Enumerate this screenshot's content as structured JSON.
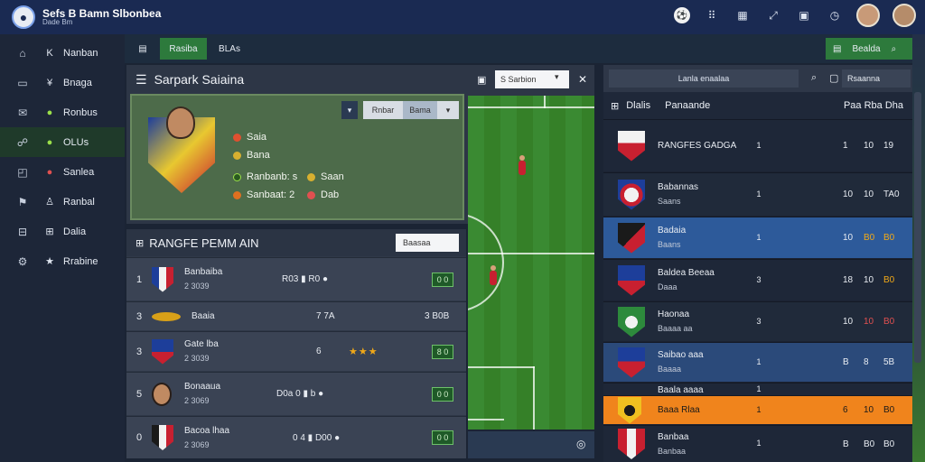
{
  "app": {
    "title": "Sefs B Bamn Slbonbea",
    "subtitle": "Dade Bm"
  },
  "topbar": {
    "icons": [
      "club-badge-icon",
      "grid-icon",
      "qr-icon",
      "expand-icon",
      "calendar-icon",
      "clock-icon"
    ],
    "icon_glyphs": [
      "",
      "⠿",
      "▦",
      "⤢",
      "▣",
      "◷"
    ]
  },
  "sidebar": {
    "items": [
      {
        "icon": "K",
        "label": "Nanban"
      },
      {
        "icon": "¥",
        "label": "Bnaga"
      },
      {
        "icon": "✉",
        "label": "Ronbus"
      },
      {
        "icon": "☍",
        "label": "OLUs"
      },
      {
        "icon": "◉",
        "label": "Sanlea"
      },
      {
        "icon": "⚑",
        "label": "Ranbal"
      },
      {
        "icon": "⊞",
        "label": "Dalia"
      },
      {
        "icon": "★",
        "label": "Rrabine"
      }
    ],
    "active_index": 3
  },
  "toolbar": {
    "left_icon": "▤",
    "tab_active": "Rasiba",
    "tab_other": "BLAs",
    "right_label": "Bealda",
    "right_icon": "▤",
    "right_search": "⌕"
  },
  "player_panel": {
    "title": "Sarpark Saiaina",
    "selector_left": "Rnbar",
    "selector_right": "Bama",
    "lines": [
      "Saia",
      "Bana",
      "Ranbanb: s",
      "Saan",
      "Sanbaat: 2",
      "Dab"
    ]
  },
  "search": {
    "value": "S Sarbion"
  },
  "ranking": {
    "title": "RANGFE PEMM AIN",
    "dropdown": "Baasaa",
    "rows": [
      {
        "num": "1",
        "name": "Banbaiba",
        "sub": "2 3039",
        "cols": "R03  ▮  R0  ●",
        "badge": "0 0"
      },
      {
        "num": "3",
        "name": "Baaia",
        "sub": "",
        "cols": "7  7A",
        "extra": "3  B0B",
        "badge": ""
      },
      {
        "num": "3",
        "name": "Gate lba",
        "sub": "2 3039",
        "cols": "6",
        "stars": "★★★",
        "badge": "8 0"
      },
      {
        "num": "5",
        "name": "Bonaaua",
        "sub": "2 3069",
        "cols": "D0a  0 ▮ b  ●",
        "badge": "0 0"
      },
      {
        "num": "0",
        "name": "Bacoa lhaa",
        "sub": "2 3069",
        "cols": "0 4  ▮  D00  ●",
        "badge": "0 0"
      }
    ]
  },
  "standings": {
    "search_label": "Lanla enaalaa",
    "dropdown": "Rsaanna",
    "header": {
      "left": "Dlalis",
      "mid": "Panaande",
      "right": "Paa Rba Dha"
    },
    "rows": [
      {
        "name": "RANGFES GADGA",
        "sub": "",
        "mid": "1",
        "c1": "1",
        "c2": "10",
        "c3": "19"
      },
      {
        "name": "Babannas",
        "sub": "Saans",
        "mid": "1",
        "c1": "10",
        "c2": "10",
        "c3": "TA0"
      },
      {
        "name": "Badaia",
        "sub": "Baans",
        "mid": "1",
        "c1": "10",
        "c2": "B0",
        "c3": "B0"
      },
      {
        "name": "Baldea Beeaa",
        "sub": "Daaa",
        "mid": "3",
        "c1": "18",
        "c2": "10",
        "c3": "B0"
      },
      {
        "name": "Haonaa",
        "sub": "Baaaa aa",
        "mid": "3",
        "c1": "10",
        "c2": "10",
        "c3": "B0"
      },
      {
        "name": "Saibao aaa",
        "sub": "Baaaa",
        "mid": "1",
        "c1": "B",
        "c2": "8",
        "c3": "5B"
      },
      {
        "name": "Baala aaaa",
        "sub": "",
        "mid": "1",
        "c1": "",
        "c2": "",
        "c3": ""
      },
      {
        "name": "Baaa Rlaa",
        "sub": "",
        "mid": "1",
        "c1": "6",
        "c2": "10",
        "c3": "B0"
      },
      {
        "name": "Banbaa",
        "sub": "Banbaa",
        "mid": "1",
        "c1": "B",
        "c2": "B0",
        "c3": "B0"
      }
    ]
  },
  "colors": {
    "accent_green": "#2d7a3c",
    "highlight_blue": "#2d5a9a",
    "highlight_orange": "#f0841c"
  }
}
